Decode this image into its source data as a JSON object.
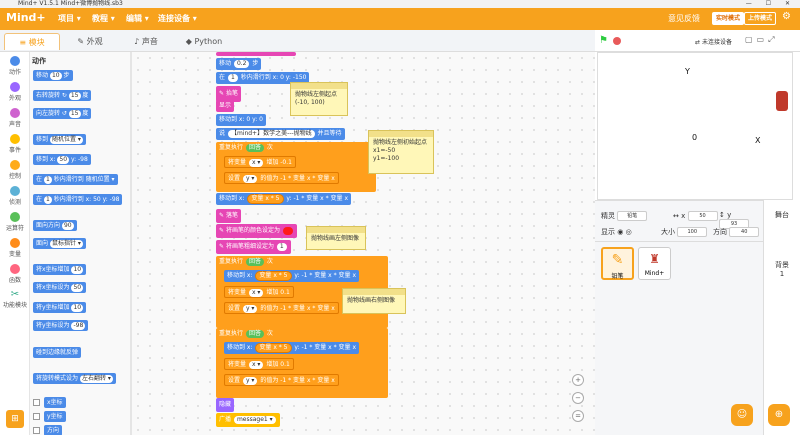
{
  "window": {
    "title": "Mind+ V1.5.1     Mind+微博抛物线.sb3",
    "controls": "—  ☐  ✕"
  },
  "menubar": {
    "logo": "Mind+",
    "items": [
      "项目 ▾",
      "教程 ▾",
      "编辑 ▾",
      "连接设备 ▾"
    ],
    "feedback": "意见反馈",
    "realtime": "实时模式",
    "upload": "上传模式",
    "settings_icon": "gear-icon"
  },
  "tabs": [
    {
      "label": "模块",
      "active": true
    },
    {
      "label": "外观",
      "active": false
    },
    {
      "label": "声音",
      "active": false
    },
    {
      "label": "Python",
      "active": false
    }
  ],
  "categories": [
    {
      "label": "动作",
      "color": "#4b8be8"
    },
    {
      "label": "外观",
      "color": "#9966ff"
    },
    {
      "label": "声音",
      "color": "#cf63cf"
    },
    {
      "label": "事件",
      "color": "#ffbf00"
    },
    {
      "label": "控制",
      "color": "#ffab19"
    },
    {
      "label": "侦测",
      "color": "#5cb1d6"
    },
    {
      "label": "运算符",
      "color": "#59c059"
    },
    {
      "label": "变量",
      "color": "#ff8c1a"
    },
    {
      "label": "函数",
      "color": "#ff6680"
    },
    {
      "label": "功能模块",
      "color": "#33aa88"
    }
  ],
  "palette": {
    "title": "动作",
    "blocks": [
      {
        "pre": "移动",
        "v1": "10",
        "post": "步"
      },
      {
        "pre": "右转旋转 ↻",
        "v1": "15",
        "post": "度"
      },
      {
        "pre": "向左旋转 ↺",
        "v1": "15",
        "post": "度"
      },
      {
        "pre": "移到",
        "v1": "随机位置 ▾",
        "post": ""
      },
      {
        "pre": "移到 x:",
        "v1": "50",
        "post": "y: -98"
      },
      {
        "pre": "在",
        "v1": "1",
        "post": "秒内滑行到 随机位置 ▾"
      },
      {
        "pre": "在",
        "v1": "1",
        "post": "秒内滑行到 x: 50 y: -98"
      },
      {
        "pre": "面向方向",
        "v1": "90",
        "post": ""
      },
      {
        "pre": "面向",
        "v1": "鼠标指针 ▾",
        "post": ""
      },
      {
        "pre": "将x坐标增加",
        "v1": "10",
        "post": ""
      },
      {
        "pre": "将x坐标设为",
        "v1": "50",
        "post": ""
      },
      {
        "pre": "将y坐标增加",
        "v1": "10",
        "post": ""
      },
      {
        "pre": "将y坐标设为",
        "v1": "-98",
        "post": ""
      },
      {
        "pre": "碰到边缘就反弹",
        "v1": "",
        "post": ""
      },
      {
        "pre": "将旋转模式设为",
        "v1": "左右翻转 ▾",
        "post": ""
      }
    ],
    "checkboxes": [
      "x坐标",
      "y坐标",
      "方向"
    ]
  },
  "workspace": {
    "blocks": [
      {
        "text": "移动",
        "v": "0.2",
        "post": "步"
      },
      {
        "text": "在",
        "v": "1",
        "post": "秒内滑行到 x: 0 y: -150"
      },
      {
        "text": "抬笔"
      },
      {
        "text": "显示"
      },
      {
        "text": "移动到 x: 0 y: 0"
      },
      {
        "text": "说",
        "v": "【mind+】数学之美---抛物线",
        "post": "并且等待"
      },
      {
        "text": "重复执行",
        "v": "回答",
        "post": "次"
      },
      {
        "text": "将变量",
        "v": "x ▾",
        "post": "增加 -0.1"
      },
      {
        "text": "设置",
        "v": "y ▾",
        "post": "的值为 -1 * 变量 x * 变量 x"
      },
      {
        "text": "移动到 x:",
        "v": "变量 x * 5",
        "post": "y: -1 * 变量 x * 变量 x"
      },
      {
        "text": "落笔"
      },
      {
        "text": "将画笔的颜色设定为"
      },
      {
        "text": "将画笔粗细设定为",
        "v": "1"
      },
      {
        "text": "重复执行",
        "v": "回答",
        "post": "次"
      },
      {
        "text": "移动到 x:",
        "v": "变量 x * 5",
        "post": "y: -1 * 变量 x * 变量 x"
      },
      {
        "text": "将变量",
        "v": "x ▾",
        "post": "增加 0.1"
      },
      {
        "text": "设置",
        "v": "y ▾",
        "post": "的值为 -1 * 变量 x * 变量 x"
      },
      {
        "text": "重复执行",
        "v": "回答",
        "post": "次"
      },
      {
        "text": "移动到 x:",
        "v": "变量 x * 5",
        "post": "y: -1 * 变量 x * 变量 x"
      },
      {
        "text": "将变量",
        "v": "x ▾",
        "post": "增加 0.1"
      },
      {
        "text": "设置",
        "v": "y ▾",
        "post": "的值为 -1 * 变量 x * 变量 x"
      },
      {
        "text": "隐藏"
      },
      {
        "text": "广播",
        "v": "message1 ▾"
      }
    ],
    "notes": [
      "抛物线左侧起点\n(-10, 100)",
      "抛物线左侧初始起点\nx1=-50\ny1=-100",
      "抛物线画左侧图像",
      "抛物线画右侧图像"
    ],
    "zoom": [
      "+",
      "−",
      "="
    ]
  },
  "stage": {
    "device_status": "未连接设备",
    "label_y": "Y",
    "label_o": "0",
    "label_x": "X"
  },
  "sprite_info": {
    "sprite_label": "精灵",
    "sprite_name": "铅笔",
    "x_label": "x",
    "x": "50",
    "y_label": "y",
    "y": "93",
    "show_label": "显示",
    "size_label": "大小",
    "size": "100",
    "direction_label": "方向",
    "direction": "40",
    "sprites": [
      "铅笔",
      "Mind+"
    ]
  },
  "stage_panel": {
    "title": "舞台",
    "backdrop_label": "背景",
    "backdrop_count": "1"
  }
}
